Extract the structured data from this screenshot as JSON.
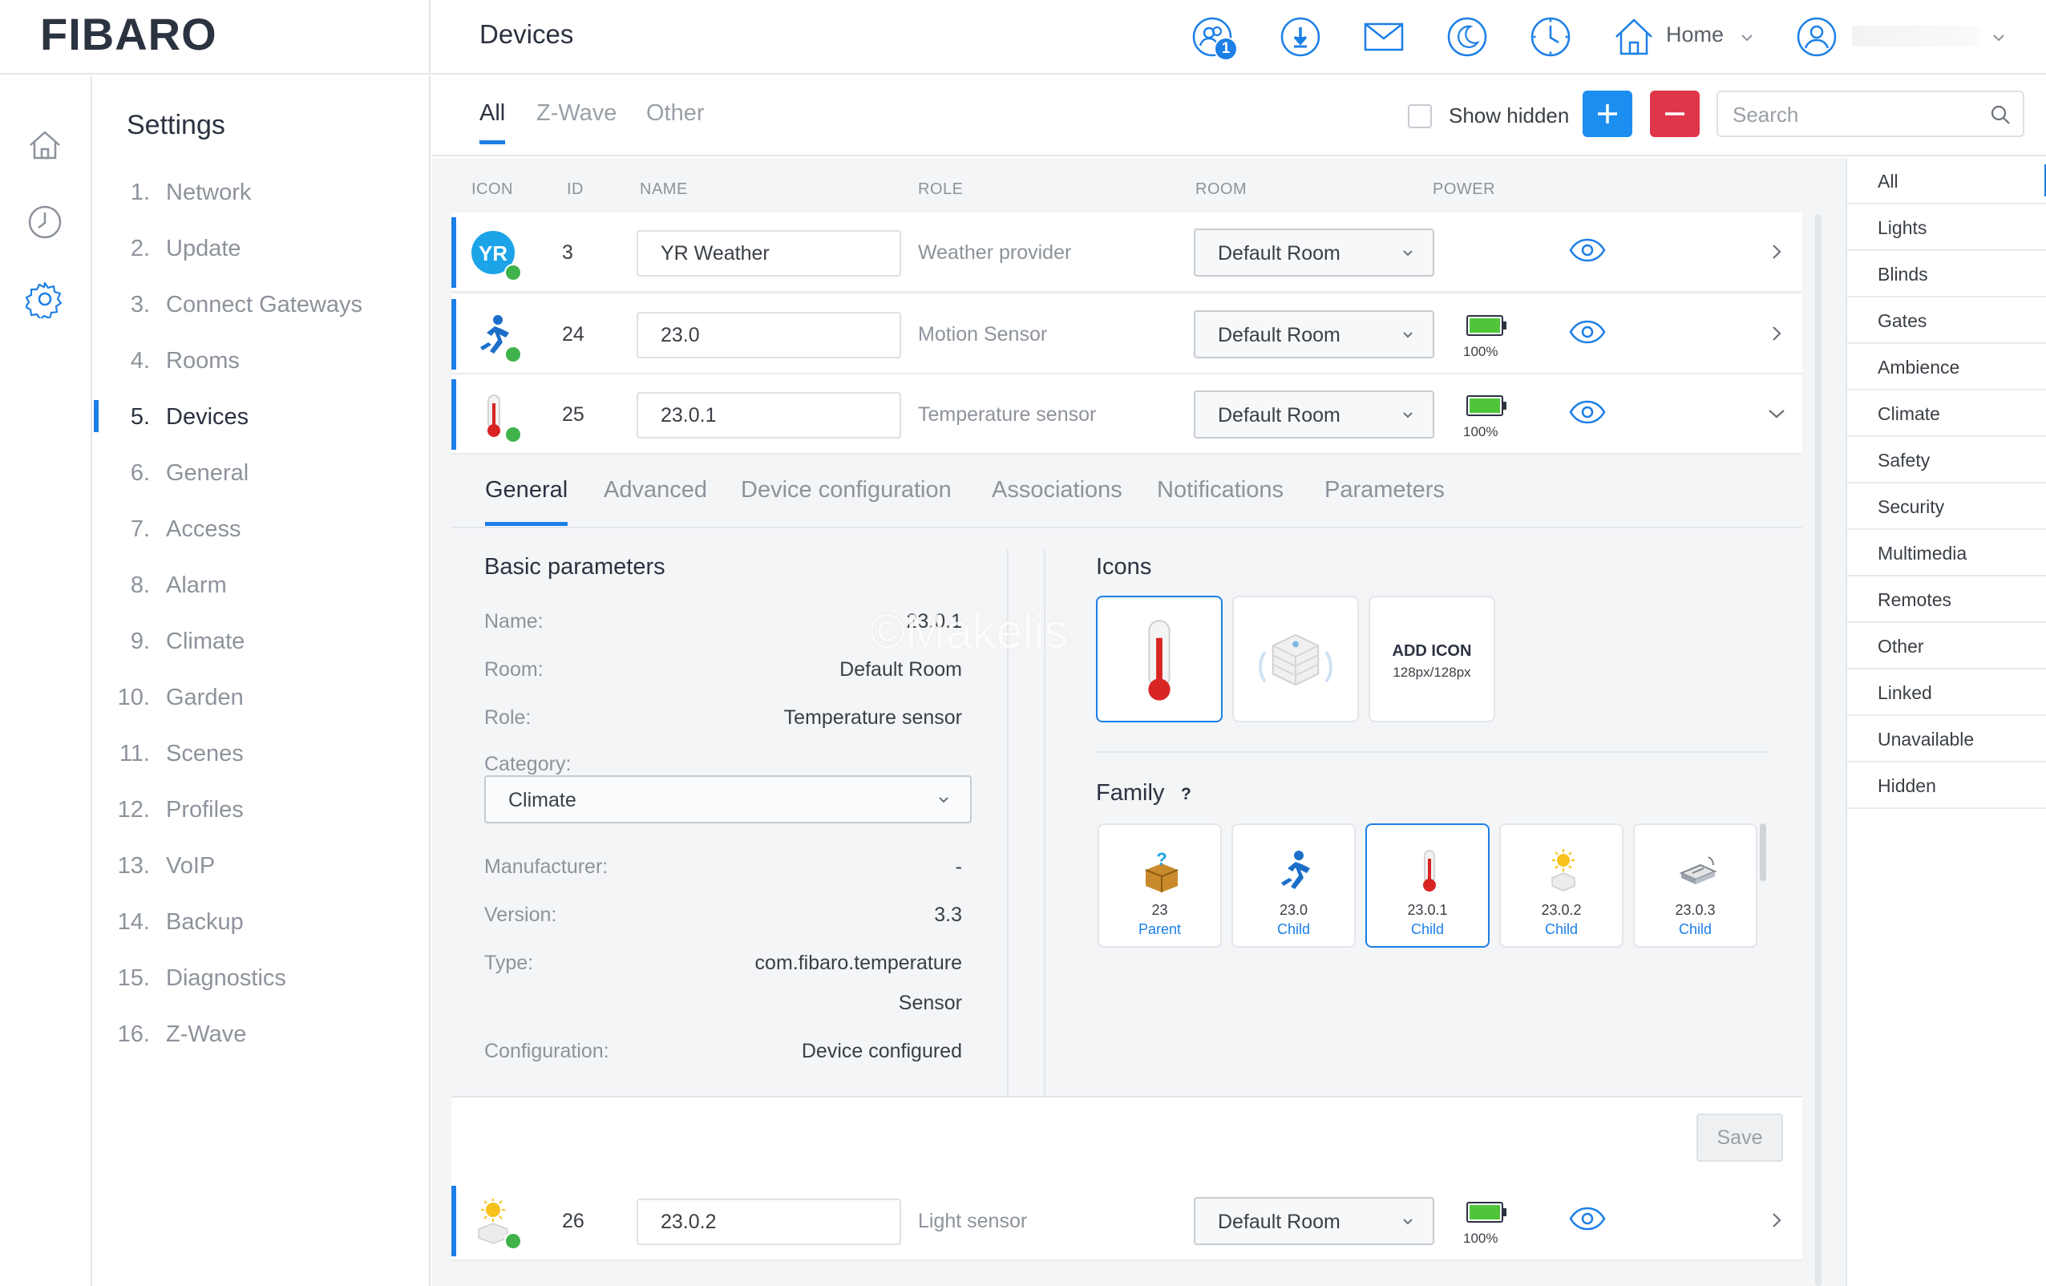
{
  "app": {
    "logo": "FIBARO",
    "page_title": "Devices"
  },
  "topbar": {
    "users_badge": "1",
    "home_label": "Home"
  },
  "settings": {
    "title": "Settings",
    "items": [
      {
        "num": "1.",
        "label": "Network"
      },
      {
        "num": "2.",
        "label": "Update"
      },
      {
        "num": "3.",
        "label": "Connect Gateways"
      },
      {
        "num": "4.",
        "label": "Rooms"
      },
      {
        "num": "5.",
        "label": "Devices"
      },
      {
        "num": "6.",
        "label": "General"
      },
      {
        "num": "7.",
        "label": "Access"
      },
      {
        "num": "8.",
        "label": "Alarm"
      },
      {
        "num": "9.",
        "label": "Climate"
      },
      {
        "num": "10.",
        "label": "Garden"
      },
      {
        "num": "11.",
        "label": "Scenes"
      },
      {
        "num": "12.",
        "label": "Profiles"
      },
      {
        "num": "13.",
        "label": "VoIP"
      },
      {
        "num": "14.",
        "label": "Backup"
      },
      {
        "num": "15.",
        "label": "Diagnostics"
      },
      {
        "num": "16.",
        "label": "Z-Wave"
      }
    ]
  },
  "filters": {
    "tabs": [
      "All",
      "Z-Wave",
      "Other"
    ],
    "show_hidden": "Show hidden",
    "search_placeholder": "Search"
  },
  "columns": {
    "icon": "ICON",
    "id": "ID",
    "name": "NAME",
    "role": "ROLE",
    "room": "ROOM",
    "power": "POWER"
  },
  "devices": [
    {
      "id": "3",
      "name": "YR Weather",
      "role": "Weather provider",
      "room": "Default Room",
      "power": ""
    },
    {
      "id": "24",
      "name": "23.0",
      "role": "Motion Sensor",
      "room": "Default Room",
      "power": "100%"
    },
    {
      "id": "25",
      "name": "23.0.1",
      "role": "Temperature sensor",
      "room": "Default Room",
      "power": "100%"
    },
    {
      "id": "26",
      "name": "23.0.2",
      "role": "Light sensor",
      "room": "Default Room",
      "power": "100%"
    }
  ],
  "detail_tabs": [
    "General",
    "Advanced",
    "Device configuration",
    "Associations",
    "Notifications",
    "Parameters"
  ],
  "basic": {
    "title": "Basic parameters",
    "name_label": "Name:",
    "name_value": "23.0.1",
    "room_label": "Room:",
    "room_value": "Default Room",
    "role_label": "Role:",
    "role_value": "Temperature sensor",
    "category_label": "Category:",
    "category_value": "Climate",
    "manufacturer_label": "Manufacturer:",
    "manufacturer_value": "-",
    "version_label": "Version:",
    "version_value": "3.3",
    "type_label": "Type:",
    "type_value_1": "com.fibaro.temperature",
    "type_value_2": "Sensor",
    "configuration_label": "Configuration:",
    "configuration_value": "Device configured"
  },
  "watermark": "©Makelis",
  "icons": {
    "title": "Icons",
    "add_title": "ADD ICON",
    "add_sub": "128px/128px"
  },
  "family": {
    "title": "Family",
    "help": "?",
    "members": [
      {
        "id": "23",
        "role": "Parent",
        "icon": "box-question-icon"
      },
      {
        "id": "23.0",
        "role": "Child",
        "icon": "running-man-icon"
      },
      {
        "id": "23.0.1",
        "role": "Child",
        "icon": "thermometer-icon"
      },
      {
        "id": "23.0.2",
        "role": "Child",
        "icon": "sun-sensor-icon"
      },
      {
        "id": "23.0.3",
        "role": "Child",
        "icon": "vibration-sensor-icon"
      }
    ]
  },
  "save_label": "Save",
  "categories": [
    "All",
    "Lights",
    "Blinds",
    "Gates",
    "Ambience",
    "Climate",
    "Safety",
    "Security",
    "Multimedia",
    "Remotes",
    "Other",
    "Linked",
    "Unavailable",
    "Hidden"
  ],
  "colors": {
    "accent": "#1c7fe6",
    "danger": "#e0364a",
    "ok": "#3fb24b"
  }
}
